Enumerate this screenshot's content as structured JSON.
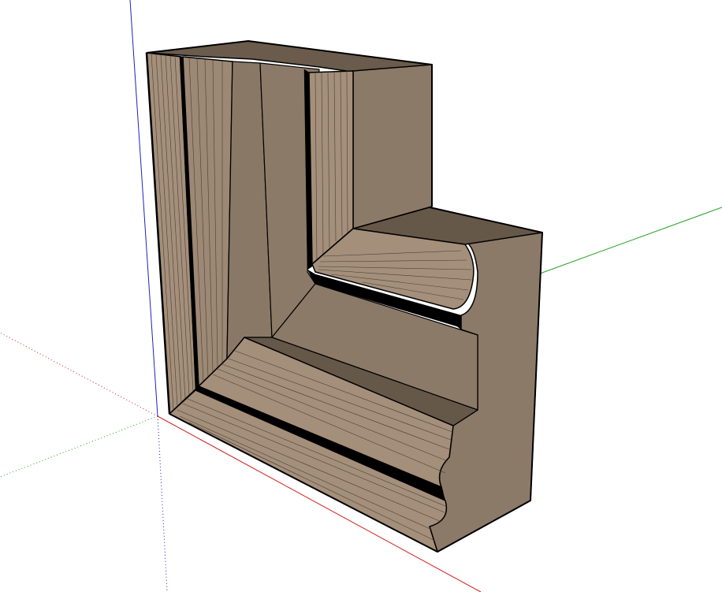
{
  "scene": {
    "model": "moulding-corner",
    "background_color": "#ffffff",
    "colors": {
      "face_light": "#8c7a69",
      "face_mid": "#7e6c5b",
      "face_dark": "#665849",
      "face_top": "#6a5b4c",
      "edge": "#000000",
      "axis_red": "#d02020",
      "axis_green": "#20a020",
      "axis_blue": "#2020c0"
    }
  }
}
